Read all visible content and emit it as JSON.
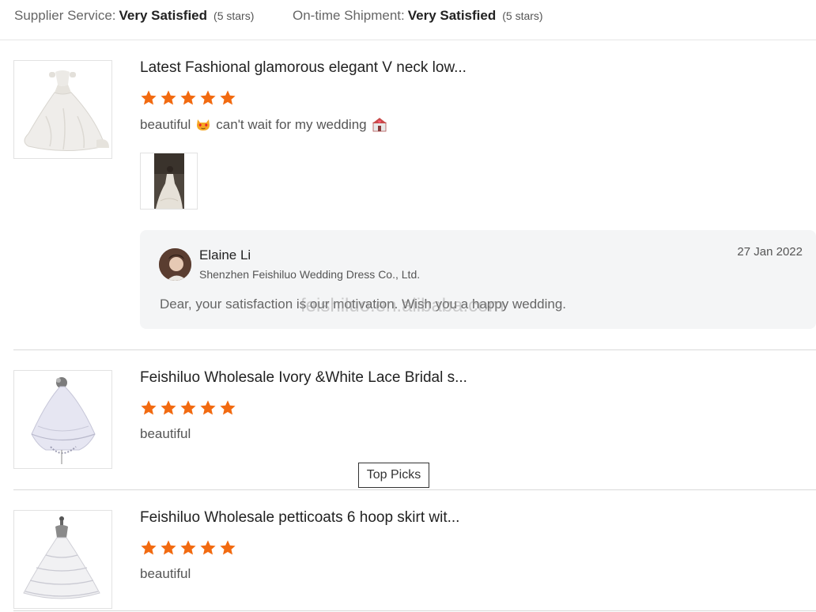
{
  "summary": {
    "supplier_service_label": "Supplier Service:",
    "supplier_service_value": "Very Satisfied",
    "supplier_service_note": "(5 stars)",
    "shipment_label": "On-time Shipment:",
    "shipment_value": "Very Satisfied",
    "shipment_note": "(5 stars)"
  },
  "colors": {
    "star": "#f26a10",
    "accent_border": "#e6e6e6",
    "reply_bg": "#f4f5f6"
  },
  "reviews": [
    {
      "title": "Latest Fashional glamorous elegant V neck low...",
      "rating": 5,
      "text_part1": "beautiful",
      "emoji1": "heart-eyes-cat-emoji",
      "text_part2": "can't wait for my wedding",
      "emoji2": "wedding-chapel-emoji",
      "reply": {
        "name": "Elaine Li",
        "company": "Shenzhen Feishiluo Wedding Dress Co., Ltd.",
        "date": "27 Jan 2022",
        "text": "Dear, your satisfaction is our motivation. Wish you a happy wedding.",
        "watermark": "feishiluo.en.alibaba.com"
      }
    },
    {
      "title": "Feishiluo Wholesale Ivory &White Lace Bridal s...",
      "rating": 5,
      "text": "beautiful"
    },
    {
      "title": "Feishiluo Wholesale petticoats 6 hoop skirt wit...",
      "rating": 5,
      "text": "beautiful"
    }
  ],
  "tooltip": {
    "label": "Top Picks"
  }
}
